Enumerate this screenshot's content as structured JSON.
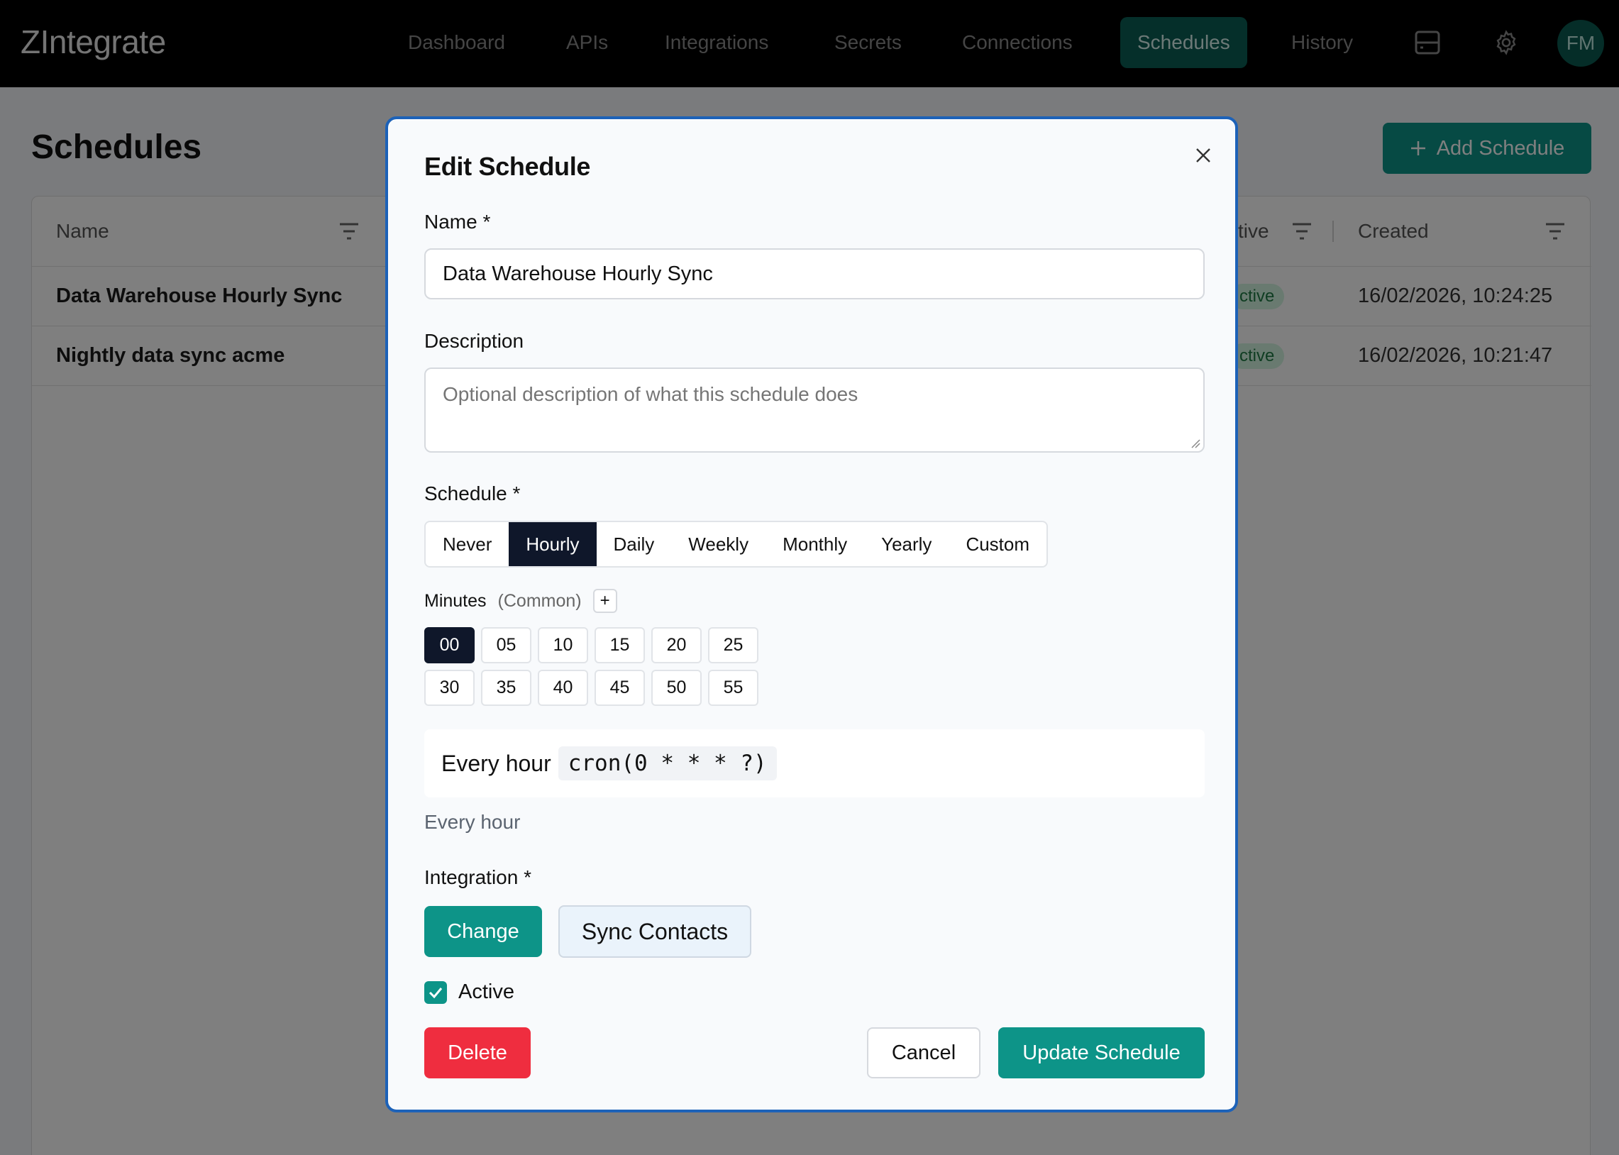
{
  "app": {
    "title": "ZIntegrate"
  },
  "nav": {
    "items": [
      {
        "label": "Dashboard"
      },
      {
        "label": "APIs"
      },
      {
        "label": "Integrations"
      },
      {
        "label": "Secrets"
      },
      {
        "label": "Connections"
      },
      {
        "label": "Schedules",
        "active": true
      },
      {
        "label": "History"
      }
    ],
    "icons": [
      "server-icon",
      "gear-icon"
    ],
    "avatar_initials": "FM"
  },
  "page": {
    "title": "Schedules",
    "add_button": "Add Schedule",
    "table": {
      "columns": [
        "Name",
        "tive",
        "Created"
      ],
      "rows": [
        {
          "name": "Data Warehouse Hourly Sync",
          "status": "ctive",
          "created": "16/02/2026, 10:24:25"
        },
        {
          "name": "Nightly data sync acme",
          "status": "ctive",
          "created": "16/02/2026, 10:21:47"
        }
      ]
    }
  },
  "modal": {
    "title": "Edit Schedule",
    "name_label": "Name *",
    "name_value": "Data Warehouse Hourly Sync",
    "description_label": "Description",
    "description_placeholder": "Optional description of what this schedule does",
    "schedule_label": "Schedule *",
    "schedule_options": [
      "Never",
      "Hourly",
      "Daily",
      "Weekly",
      "Monthly",
      "Yearly",
      "Custom"
    ],
    "schedule_selected": "Hourly",
    "minutes_label": "Minutes",
    "minutes_common": "(Common)",
    "minutes_plus": "+",
    "minutes": [
      "00",
      "05",
      "10",
      "15",
      "20",
      "25",
      "30",
      "35",
      "40",
      "45",
      "50",
      "55"
    ],
    "minutes_selected": "00",
    "cron_text": "Every hour",
    "cron_expression": "cron(0 * * * ?)",
    "cron_helper": "Every hour",
    "integration_label": "Integration *",
    "change_button": "Change",
    "integration_name": "Sync Contacts",
    "active_label": "Active",
    "active_checked": true,
    "delete_button": "Delete",
    "cancel_button": "Cancel",
    "update_button": "Update Schedule"
  },
  "colors": {
    "accent": "#0d9488",
    "danger": "#ef2d3f",
    "dark": "#0f172a",
    "focus_border": "#1d62b8"
  }
}
